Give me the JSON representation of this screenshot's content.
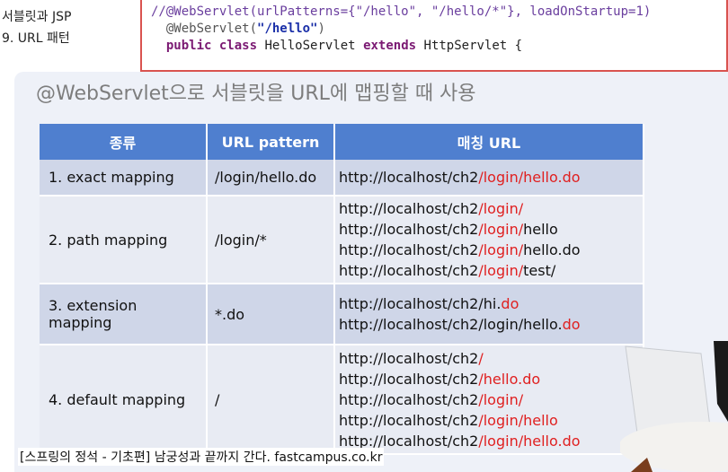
{
  "course": {
    "line1": "서블릿과 JSP",
    "line2": "9. URL 패턴"
  },
  "code": {
    "line1": "//@WebServlet(urlPatterns={\"/hello\", \"/hello/*\"}, loadOnStartup=1)",
    "line2_anno": "@WebServlet(",
    "line2_str": "\"/hello\"",
    "line2_end": ")",
    "line3_kw1": "public",
    "line3_kw2": "class",
    "line3_name": "HelloServlet",
    "line3_kw3": "extends",
    "line3_rest": "HttpServlet {"
  },
  "heading": "@WebServlet으로 서블릿을 URL에 맵핑할 때 사용",
  "table": {
    "headers": [
      "종류",
      "URL pattern",
      "매칭 URL"
    ],
    "rows": [
      {
        "kind": "1. exact mapping",
        "pattern": "/login/hello.do",
        "urls": [
          {
            "base": "http://localhost/ch2",
            "hl": "/login/hello.do",
            "tail": ""
          }
        ]
      },
      {
        "kind": "2. path mapping",
        "pattern": "/login/*",
        "urls": [
          {
            "base": "http://localhost/ch2",
            "hl": "/login/",
            "tail": ""
          },
          {
            "base": "http://localhost/ch2",
            "hl": "/login/",
            "tail": "hello"
          },
          {
            "base": "http://localhost/ch2",
            "hl": "/login/",
            "tail": "hello.do"
          },
          {
            "base": "http://localhost/ch2",
            "hl": "/login/",
            "tail": "test/"
          }
        ]
      },
      {
        "kind": "3. extension mapping",
        "pattern": "*.do",
        "urls": [
          {
            "base": "http://localhost/ch2/hi.",
            "hl": "do",
            "tail": ""
          },
          {
            "base": "http://localhost/ch2/login/hello.",
            "hl": "do",
            "tail": ""
          }
        ]
      },
      {
        "kind": "4. default mapping",
        "pattern": "/",
        "urls": [
          {
            "base": "http://localhost/ch2",
            "hl": "/",
            "tail": ""
          },
          {
            "base": "http://localhost/ch2",
            "hl": "/hello.do",
            "tail": ""
          },
          {
            "base": "http://localhost/ch2",
            "hl": "/login/",
            "tail": ""
          },
          {
            "base": "http://localhost/ch2",
            "hl": "/login/hello",
            "tail": ""
          },
          {
            "base": "http://localhost/ch2",
            "hl": "/login/hello.do",
            "tail": ""
          }
        ]
      }
    ]
  },
  "footer": "[스프링의 정석 - 기초편] 남궁성과 끝까지 간다.  fastcampus.co.kr",
  "colors": {
    "header_bg": "#4f7fcf",
    "highlight": "#e02020",
    "code_border": "#d9534f"
  }
}
